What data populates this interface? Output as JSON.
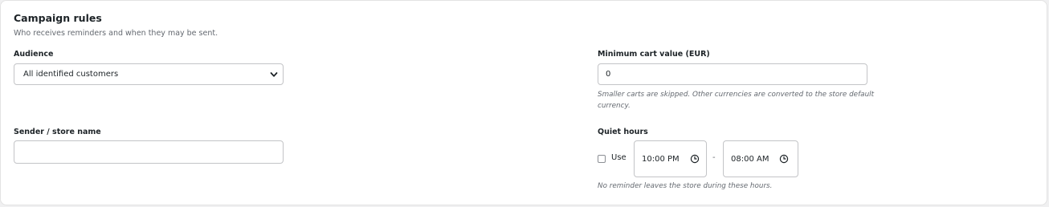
{
  "section": {
    "title": "Campaign rules",
    "subtitle": "Who receives reminders and when they may be sent."
  },
  "audience": {
    "label": "Audience",
    "selected": "All identified customers"
  },
  "min_cart": {
    "label": "Minimum cart value (EUR)",
    "value": "0",
    "help_line1": "Smaller carts are skipped. Other currencies are converted to the store default",
    "help_line2": "currency."
  },
  "sender": {
    "label": "Sender / store name",
    "value": ""
  },
  "quiet_hours": {
    "label": "Quiet hours",
    "use_label": "Use",
    "use_checked": false,
    "start": "10:00 PM",
    "separator": "-",
    "end": "08:00 AM",
    "help": "No reminder leaves the store during these hours."
  },
  "icons": {
    "select_arrow": "chevron-down-icon",
    "time": "clock-icon"
  }
}
